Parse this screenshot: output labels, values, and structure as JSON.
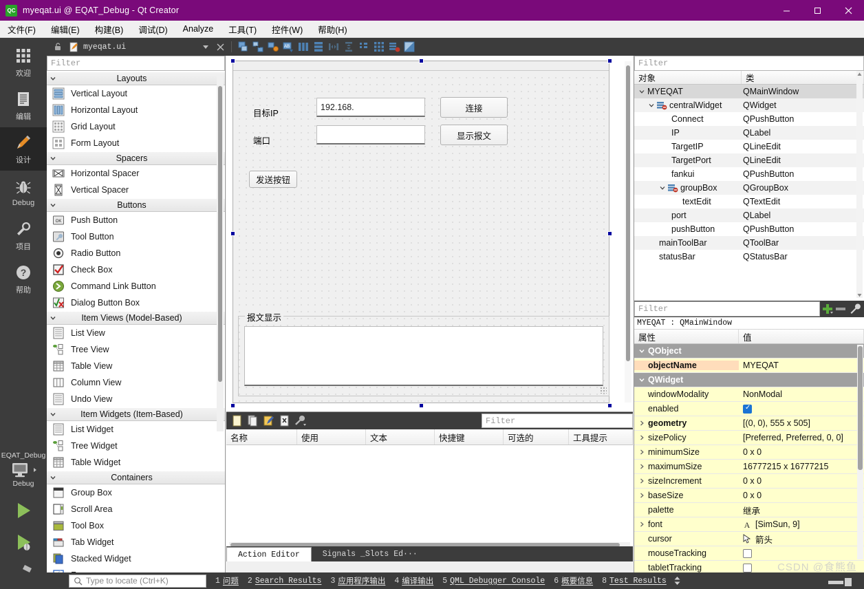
{
  "window": {
    "title": "myeqat.ui @ EQAT_Debug - Qt Creator",
    "logo_text": "QC",
    "minimize": "−",
    "maximize": "☐",
    "close": "✕",
    "titlebar_color": "#7a0a7a"
  },
  "menubar": [
    {
      "label": "文件(F)"
    },
    {
      "label": "编辑(E)"
    },
    {
      "label": "构建(B)"
    },
    {
      "label": "调试(D)"
    },
    {
      "label": "Analyze"
    },
    {
      "label": "工具(T)"
    },
    {
      "label": "控件(W)"
    },
    {
      "label": "帮助(H)"
    }
  ],
  "modebar": {
    "items": [
      {
        "label": "欢迎",
        "icon": "grid-icon",
        "active": false
      },
      {
        "label": "编辑",
        "icon": "document-icon",
        "active": false
      },
      {
        "label": "设计",
        "icon": "pencil-icon",
        "active": true
      },
      {
        "label": "Debug",
        "icon": "bug-icon",
        "active": false
      },
      {
        "label": "项目",
        "icon": "wrench-icon",
        "active": false
      },
      {
        "label": "帮助",
        "icon": "question-icon",
        "active": false
      }
    ],
    "kit_name": "EQAT_Debug",
    "kit_config": "Debug",
    "run_label": "run-icon",
    "debug_label": "debug-icon",
    "build_label": "build-icon"
  },
  "doctoolbar": {
    "filename": "myeqat.ui",
    "lock_icon": "unlocked-icon",
    "file_icon": "ui-file-icon",
    "dropdown_icon": "chevron-down-icon",
    "close_icon": "close-icon",
    "tools": [
      "edit-widgets-icon",
      "edit-signals-slots-icon",
      "edit-buddies-icon",
      "edit-tab-order-icon",
      "layout-horizontally-icon",
      "layout-vertically-icon",
      "layout-in-splitter-h-icon",
      "layout-in-splitter-v-icon",
      "layout-form-icon",
      "layout-grid-icon",
      "break-layout-icon",
      "adjust-size-icon"
    ]
  },
  "widgetbox": {
    "filter_placeholder": "Filter",
    "categories": [
      {
        "name": "Layouts",
        "items": [
          {
            "label": "Vertical Layout",
            "icon": "vertical-layout-icon"
          },
          {
            "label": "Horizontal Layout",
            "icon": "horizontal-layout-icon"
          },
          {
            "label": "Grid Layout",
            "icon": "grid-layout-icon"
          },
          {
            "label": "Form Layout",
            "icon": "form-layout-icon"
          }
        ]
      },
      {
        "name": "Spacers",
        "items": [
          {
            "label": "Horizontal Spacer",
            "icon": "horizontal-spacer-icon"
          },
          {
            "label": "Vertical Spacer",
            "icon": "vertical-spacer-icon"
          }
        ]
      },
      {
        "name": "Buttons",
        "items": [
          {
            "label": "Push Button",
            "icon": "push-button-icon"
          },
          {
            "label": "Tool Button",
            "icon": "tool-button-icon"
          },
          {
            "label": "Radio Button",
            "icon": "radio-button-icon"
          },
          {
            "label": "Check Box",
            "icon": "check-box-icon"
          },
          {
            "label": "Command Link Button",
            "icon": "command-link-icon"
          },
          {
            "label": "Dialog Button Box",
            "icon": "dialog-button-box-icon"
          }
        ]
      },
      {
        "name": "Item Views (Model-Based)",
        "items": [
          {
            "label": "List View",
            "icon": "list-view-icon"
          },
          {
            "label": "Tree View",
            "icon": "tree-view-icon"
          },
          {
            "label": "Table View",
            "icon": "table-view-icon"
          },
          {
            "label": "Column View",
            "icon": "column-view-icon"
          },
          {
            "label": "Undo View",
            "icon": "undo-view-icon"
          }
        ]
      },
      {
        "name": "Item Widgets (Item-Based)",
        "items": [
          {
            "label": "List Widget",
            "icon": "list-widget-icon"
          },
          {
            "label": "Tree Widget",
            "icon": "tree-widget-icon"
          },
          {
            "label": "Table Widget",
            "icon": "table-widget-icon"
          }
        ]
      },
      {
        "name": "Containers",
        "items": [
          {
            "label": "Group Box",
            "icon": "group-box-icon"
          },
          {
            "label": "Scroll Area",
            "icon": "scroll-area-icon"
          },
          {
            "label": "Tool Box",
            "icon": "tool-box-icon"
          },
          {
            "label": "Tab Widget",
            "icon": "tab-widget-icon"
          },
          {
            "label": "Stacked Widget",
            "icon": "stacked-widget-icon"
          },
          {
            "label": "Frame",
            "icon": "frame-icon"
          }
        ]
      }
    ]
  },
  "form": {
    "ip_label": "目标IP",
    "ip_value": "192.168.",
    "port_label": "端口",
    "port_value": "",
    "connect_button": "连接",
    "show_message_button": "显示报文",
    "send_button": "发送按钮",
    "groupbox_title": "报文显示",
    "textedit_value": ""
  },
  "action_editor": {
    "filter_placeholder": "Filter",
    "toolbar_icons": [
      "new-action-icon",
      "copy-action-icon",
      "edit-action-icon",
      "delete-action-icon",
      "configure-icon"
    ],
    "columns": [
      "名称",
      "使用",
      "文本",
      "快捷键",
      "可选的",
      "工具提示"
    ],
    "rows": [],
    "tabs": [
      {
        "label": "Action Editor",
        "active": true
      },
      {
        "label": "Signals _Slots Ed···",
        "active": false
      }
    ]
  },
  "object_inspector": {
    "filter_placeholder": "Filter",
    "columns": [
      "对象",
      "类"
    ],
    "rows": [
      {
        "name": "MYEQAT",
        "class": "QMainWindow",
        "indent": 0,
        "expander": "expanded",
        "icon": "",
        "selected": true
      },
      {
        "name": "centralWidget",
        "class": "QWidget",
        "indent": 1,
        "expander": "expanded",
        "icon": "no-layout-icon",
        "selected": false
      },
      {
        "name": "Connect",
        "class": "QPushButton",
        "indent": 2,
        "expander": "",
        "icon": "",
        "selected": false
      },
      {
        "name": "IP",
        "class": "QLabel",
        "indent": 2,
        "expander": "",
        "icon": "",
        "selected": false
      },
      {
        "name": "TargetIP",
        "class": "QLineEdit",
        "indent": 2,
        "expander": "",
        "icon": "",
        "selected": false
      },
      {
        "name": "TargetPort",
        "class": "QLineEdit",
        "indent": 2,
        "expander": "",
        "icon": "",
        "selected": false
      },
      {
        "name": "fankui",
        "class": "QPushButton",
        "indent": 2,
        "expander": "",
        "icon": "",
        "selected": false
      },
      {
        "name": "groupBox",
        "class": "QGroupBox",
        "indent": 2,
        "expander": "expanded",
        "icon": "no-layout-icon",
        "selected": false
      },
      {
        "name": "textEdit",
        "class": "QTextEdit",
        "indent": 3,
        "expander": "",
        "icon": "",
        "selected": false
      },
      {
        "name": "port",
        "class": "QLabel",
        "indent": 2,
        "expander": "",
        "icon": "",
        "selected": false
      },
      {
        "name": "pushButton",
        "class": "QPushButton",
        "indent": 2,
        "expander": "",
        "icon": "",
        "selected": false
      },
      {
        "name": "mainToolBar",
        "class": "QToolBar",
        "indent": 1,
        "expander": "",
        "icon": "",
        "selected": false
      },
      {
        "name": "statusBar",
        "class": "QStatusBar",
        "indent": 1,
        "expander": "",
        "icon": "",
        "selected": false
      }
    ]
  },
  "property_editor": {
    "filter_placeholder": "Filter",
    "add_icon": "plus-icon",
    "remove_icon": "minus-icon",
    "configure_icon": "wrench-icon",
    "object_line": "MYEQAT : QMainWindow",
    "columns": [
      "属性",
      "值"
    ],
    "rows": [
      {
        "name": "QObject",
        "value": "",
        "kind": "group"
      },
      {
        "name": "objectName",
        "value": "MYEQAT",
        "kind": "peach",
        "expander": ""
      },
      {
        "name": "QWidget",
        "value": "",
        "kind": "group"
      },
      {
        "name": "windowModality",
        "value": "NonModal",
        "kind": "plain",
        "expander": ""
      },
      {
        "name": "enabled",
        "value": "",
        "kind": "checkbox-on",
        "expander": ""
      },
      {
        "name": "geometry",
        "value": "[(0, 0), 555 x 505]",
        "kind": "bold",
        "expander": "collapsed"
      },
      {
        "name": "sizePolicy",
        "value": "[Preferred, Preferred, 0, 0]",
        "kind": "plain",
        "expander": "collapsed"
      },
      {
        "name": "minimumSize",
        "value": "0 x 0",
        "kind": "plain",
        "expander": "collapsed"
      },
      {
        "name": "maximumSize",
        "value": "16777215 x 16777215",
        "kind": "plain",
        "expander": "collapsed"
      },
      {
        "name": "sizeIncrement",
        "value": "0 x 0",
        "kind": "plain",
        "expander": "collapsed"
      },
      {
        "name": "baseSize",
        "value": "0 x 0",
        "kind": "plain",
        "expander": "collapsed"
      },
      {
        "name": "palette",
        "value": "继承",
        "kind": "plain",
        "expander": ""
      },
      {
        "name": "font",
        "value": "[SimSun, 9]",
        "kind": "font",
        "expander": "collapsed"
      },
      {
        "name": "cursor",
        "value": "箭头",
        "kind": "cursor",
        "expander": ""
      },
      {
        "name": "mouseTracking",
        "value": "",
        "kind": "checkbox-off",
        "expander": ""
      },
      {
        "name": "tabletTracking",
        "value": "",
        "kind": "checkbox-off",
        "expander": ""
      }
    ]
  },
  "statusbar": {
    "locator_placeholder": "Type to locate (Ctrl+K)",
    "search_icon": "search-icon",
    "items": [
      {
        "num": "1",
        "label": "问题"
      },
      {
        "num": "2",
        "label": "Search Results"
      },
      {
        "num": "3",
        "label": "应用程序输出"
      },
      {
        "num": "4",
        "label": "编译输出"
      },
      {
        "num": "5",
        "label": "QML Debugger Console"
      },
      {
        "num": "6",
        "label": "概要信息"
      },
      {
        "num": "8",
        "label": "Test Results"
      }
    ],
    "watermark": "CSDN @食熊鱼"
  }
}
